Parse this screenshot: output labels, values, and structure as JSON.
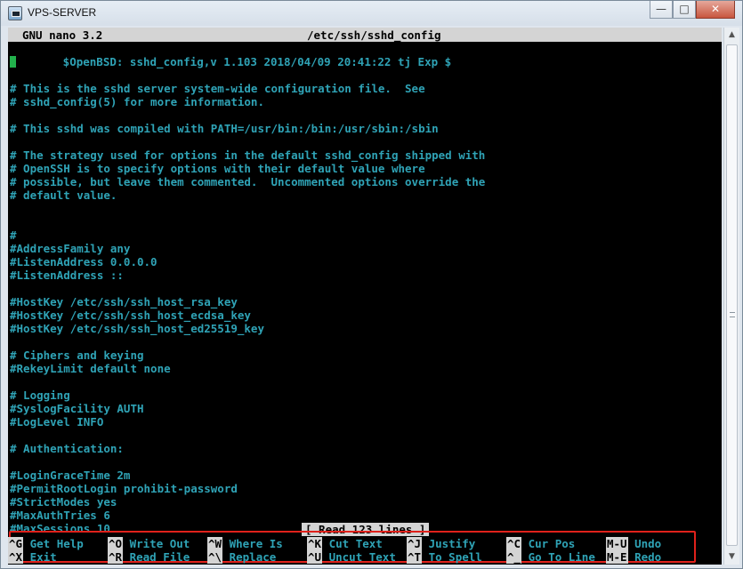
{
  "window": {
    "title": "VPS-SERVER",
    "buttons": {
      "minimize": "—",
      "maximize": "□",
      "close": "✕"
    }
  },
  "nano": {
    "version_label": "GNU nano 3.2",
    "filename": "/etc/ssh/sshd_config",
    "status_message": "[ Read 123 lines ]"
  },
  "file_lines": [
    "       $OpenBSD: sshd_config,v 1.103 2018/04/09 20:41:22 tj Exp $",
    "",
    "# This is the sshd server system-wide configuration file.  See",
    "# sshd_config(5) for more information.",
    "",
    "# This sshd was compiled with PATH=/usr/bin:/bin:/usr/sbin:/sbin",
    "",
    "# The strategy used for options in the default sshd_config shipped with",
    "# OpenSSH is to specify options with their default value where",
    "# possible, but leave them commented.  Uncommented options override the",
    "# default value.",
    "",
    "",
    "#",
    "#AddressFamily any",
    "#ListenAddress 0.0.0.0",
    "#ListenAddress ::",
    "",
    "#HostKey /etc/ssh/ssh_host_rsa_key",
    "#HostKey /etc/ssh/ssh_host_ecdsa_key",
    "#HostKey /etc/ssh/ssh_host_ed25519_key",
    "",
    "# Ciphers and keying",
    "#RekeyLimit default none",
    "",
    "# Logging",
    "#SyslogFacility AUTH",
    "#LogLevel INFO",
    "",
    "# Authentication:",
    "",
    "#LoginGraceTime 2m",
    "#PermitRootLogin prohibit-password",
    "#StrictModes yes",
    "#MaxAuthTries 6",
    "#MaxSessions 10"
  ],
  "shortcuts": {
    "row1": [
      {
        "key": "^G",
        "label": " Get Help"
      },
      {
        "key": "^O",
        "label": " Write Out"
      },
      {
        "key": "^W",
        "label": " Where Is"
      },
      {
        "key": "^K",
        "label": " Cut Text"
      },
      {
        "key": "^J",
        "label": " Justify"
      },
      {
        "key": "^C",
        "label": " Cur Pos"
      },
      {
        "key": "M-U",
        "label": " Undo"
      }
    ],
    "row2": [
      {
        "key": "^X",
        "label": " Exit"
      },
      {
        "key": "^R",
        "label": " Read File"
      },
      {
        "key": "^\\",
        "label": " Replace"
      },
      {
        "key": "^U",
        "label": " Uncut Text"
      },
      {
        "key": "^T",
        "label": " To Spell"
      },
      {
        "key": "^_",
        "label": " Go To Line"
      },
      {
        "key": "M-E",
        "label": " Redo"
      }
    ]
  },
  "colors": {
    "terminal_bg": "#000000",
    "text_cyan": "#2fa3b6",
    "cursor_green": "#22b14c",
    "highlight_bar": "#d4d4d4",
    "annotation_red": "#e0211b"
  }
}
